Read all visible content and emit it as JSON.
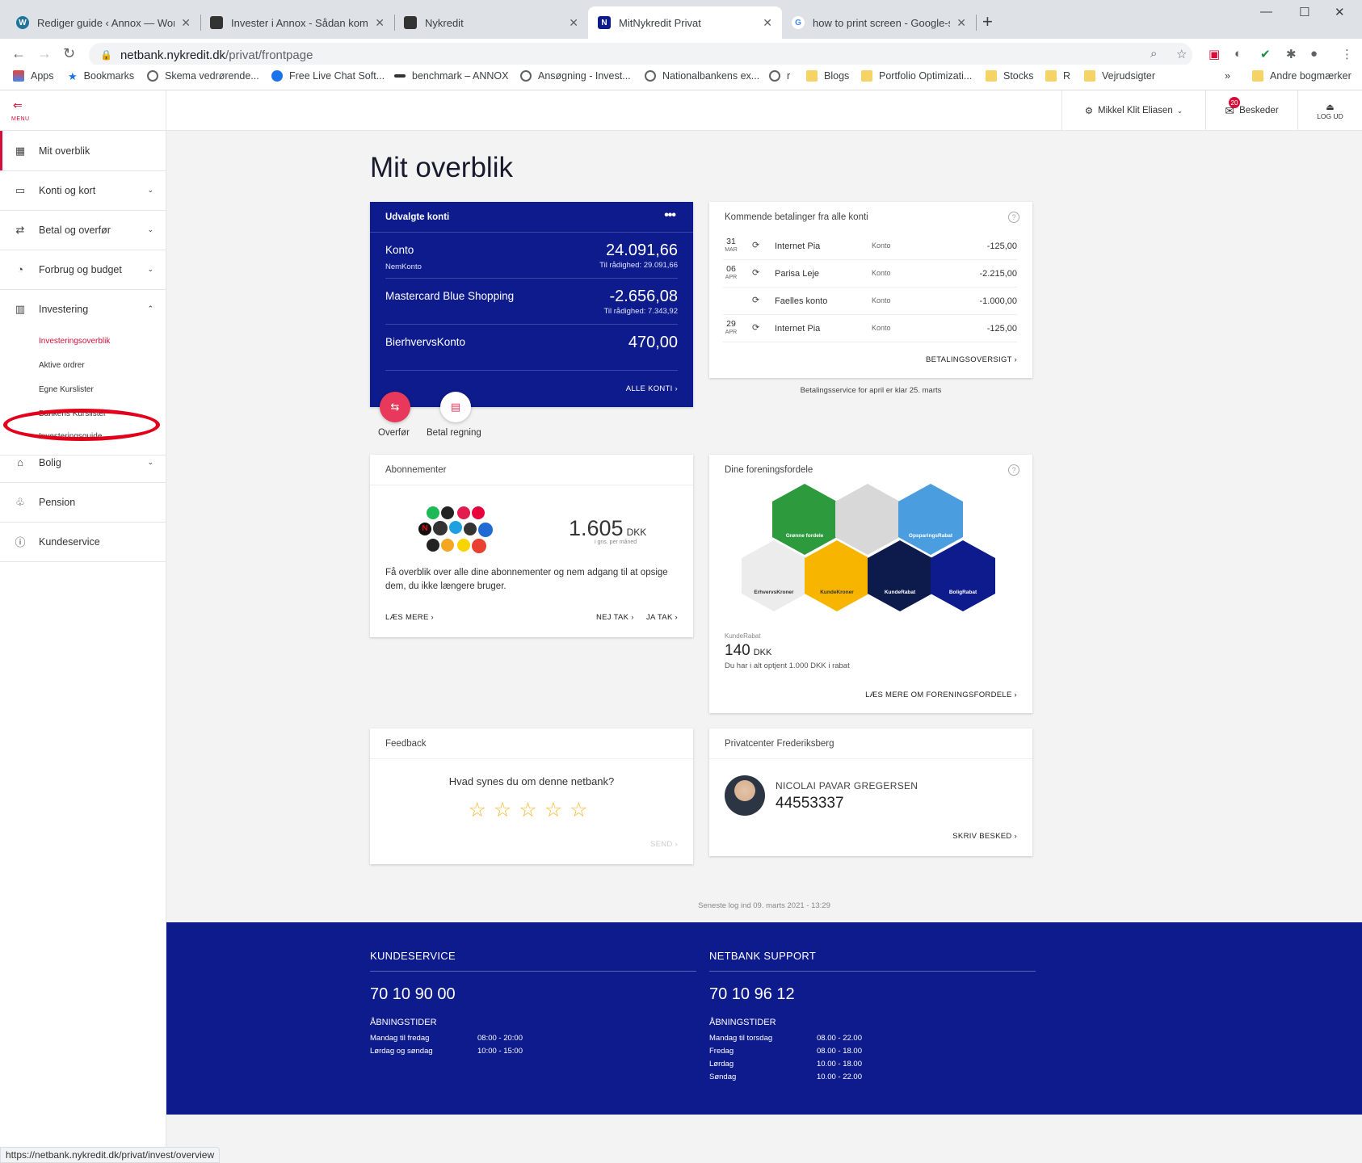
{
  "browser": {
    "tabs": [
      {
        "title": "Rediger guide ‹ Annox — WordPress",
        "icon": "wordpress-icon"
      },
      {
        "title": "Invester i Annox - Sådan kommer du i gang",
        "icon": "annox-icon"
      },
      {
        "title": "Nykredit",
        "icon": "annox-icon"
      },
      {
        "title": "MitNykredit Privat",
        "icon": "nykredit-icon"
      },
      {
        "title": "how to print screen - Google-søgning",
        "icon": "google-icon"
      }
    ],
    "url_host": "netbank.nykredit.dk",
    "url_path": "/privat/frontpage",
    "bookmarks": [
      {
        "label": "Apps",
        "icon": "apps-grid-icon"
      },
      {
        "label": "Bookmarks",
        "icon": "star-icon"
      },
      {
        "label": "Skema vedrørende...",
        "icon": "globe-icon"
      },
      {
        "label": "Free Live Chat Soft...",
        "icon": "chat-icon"
      },
      {
        "label": "benchmark – ANNOX",
        "icon": "annox-icon"
      },
      {
        "label": "Ansøgning - Invest...",
        "icon": "globe-icon"
      },
      {
        "label": "Nationalbankens ex...",
        "icon": "globe-icon"
      },
      {
        "label": "r",
        "icon": "globe-icon"
      },
      {
        "label": "Blogs",
        "icon": "folder-icon"
      },
      {
        "label": "Portfolio Optimizati...",
        "icon": "folder-icon"
      },
      {
        "label": "Stocks",
        "icon": "folder-icon"
      },
      {
        "label": "R",
        "icon": "folder-icon"
      },
      {
        "label": "Vejrudsigter",
        "icon": "folder-icon"
      }
    ],
    "other_bookmarks": "Andre bogmærker",
    "status_url": "https://netbank.nykredit.dk/privat/invest/overview"
  },
  "sidebar": {
    "menu_label": "MENU",
    "items": [
      {
        "label": "Mit overblik",
        "icon": "grid-icon"
      },
      {
        "label": "Konti og kort",
        "icon": "card-icon"
      },
      {
        "label": "Betal og overfør",
        "icon": "transfer-icon"
      },
      {
        "label": "Forbrug og budget",
        "icon": "pie-chart-icon"
      },
      {
        "label": "Investering",
        "icon": "bar-chart-icon"
      },
      {
        "label": "Bolig",
        "icon": "house-icon"
      },
      {
        "label": "Pension",
        "icon": "piggy-icon"
      },
      {
        "label": "Kundeservice",
        "icon": "help-icon"
      }
    ],
    "invest_sub": [
      "Investeringsoverblik",
      "Aktive ordrer",
      "Egne Kurslister",
      "Bankens Kurslister",
      "Investeringsguide"
    ]
  },
  "topbar": {
    "user": "Mikkel Klit Eliasen",
    "messages_label": "Beskeder",
    "messages_count": "20",
    "logout_label": "LOG UD"
  },
  "page": {
    "title": "Mit overblik"
  },
  "accounts": {
    "title": "Udvalgte konti",
    "items": [
      {
        "name": "Konto",
        "sub": "NemKonto",
        "amount": "24.091,66",
        "available": "Til rådighed: 29.091,66"
      },
      {
        "name": "Mastercard Blue Shopping",
        "sub": "",
        "amount": "-2.656,08",
        "available": "Til rådighed: 7.343,92"
      },
      {
        "name": "BierhvervsKonto",
        "sub": "",
        "amount": "470,00",
        "available": ""
      }
    ],
    "all_link": "ALLE KONTI ›",
    "transfer_label": "Overfør",
    "pay_bill_label": "Betal regning"
  },
  "payments": {
    "title": "Kommende betalinger fra alle konti",
    "rows": [
      {
        "day": "31",
        "month": "MAR",
        "name": "Internet Pia",
        "account": "Konto",
        "amount": "-125,00"
      },
      {
        "day": "06",
        "month": "APR",
        "name": "Parisa Leje",
        "account": "Konto",
        "amount": "-2.215,00"
      },
      {
        "day": "",
        "month": "",
        "name": "Faelles konto",
        "account": "Konto",
        "amount": "-1.000,00"
      },
      {
        "day": "29",
        "month": "APR",
        "name": "Internet Pia",
        "account": "Konto",
        "amount": "-125,00"
      }
    ],
    "link": "BETALINGSOVERSIGT ›",
    "note": "Betalingsservice for april er klar 25. marts"
  },
  "subscriptions": {
    "title": "Abonnementer",
    "amount": "1.605",
    "currency": "DKK",
    "amount_caption": "i gns. per måned",
    "text": "Få overblik over alle dine abonnementer og nem adgang til at opsige dem, du ikke længere bruger.",
    "read_more": "LÆS MERE ›",
    "no_thanks": "NEJ TAK ›",
    "yes_thanks": "JA TAK ›"
  },
  "benefits": {
    "title": "Dine foreningsfordele",
    "hexes": [
      "Grønne fordele",
      "OpsparingsRabat",
      "ErhvervsKroner",
      "KundeKroner",
      "KundeRabat",
      "BoligRabat"
    ],
    "caption": "KundeRabat",
    "amount": "140",
    "currency": "DKK",
    "earned": "Du har i alt optjent 1.000 DKK i rabat",
    "link": "LÆS MERE OM FORENINGSFORDELE ›"
  },
  "feedback": {
    "title": "Feedback",
    "question": "Hvad synes du om denne netbank?",
    "stars": 5,
    "send": "SEND ›"
  },
  "advisor": {
    "title": "Privatcenter Frederiksberg",
    "name": "NICOLAI PAVAR GREGERSEN",
    "phone": "44553337",
    "link": "SKRIV BESKED ›"
  },
  "last_login": "Seneste log ind 09. marts 2021 - 13:29",
  "footer": {
    "customer_service": {
      "title": "KUNDESERVICE",
      "phone": "70 10 90 00",
      "hours_title": "ÅBNINGSTIDER",
      "hours": [
        [
          "Mandag til fredag",
          "08:00 - 20:00"
        ],
        [
          "Lørdag og søndag",
          "10:00 - 15:00"
        ]
      ]
    },
    "support": {
      "title": "NETBANK SUPPORT",
      "phone": "70 10 96 12",
      "hours_title": "ÅBNINGSTIDER",
      "hours": [
        [
          "Mandag til torsdag",
          "08.00 - 22.00"
        ],
        [
          "Fredag",
          "08.00 - 18.00"
        ],
        [
          "Lørdag",
          "10.00 - 18.00"
        ],
        [
          "Søndag",
          "10.00 - 22.00"
        ]
      ]
    }
  },
  "colors": {
    "brand_red": "#d40f3a",
    "navy": "#0d1b8c"
  }
}
